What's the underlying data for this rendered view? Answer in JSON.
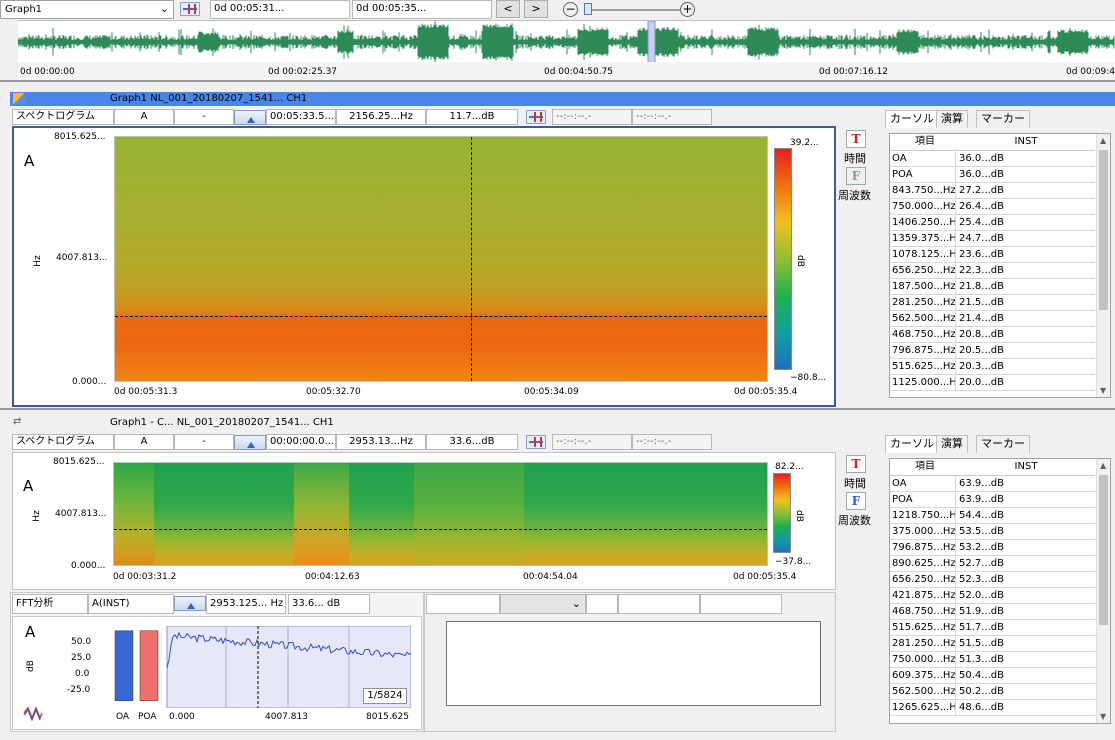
{
  "top": {
    "graph_select": "Graph1",
    "time_start": "0d 00:05:31...",
    "time_end": "0d 00:05:35...",
    "overview_ticks": [
      "0d 00:00:00",
      "0d 00:02:25.37",
      "0d 00:04:50.75",
      "0d 00:07:16.12",
      "0d 00:09:4"
    ]
  },
  "graph1": {
    "title": "Graph1  NL_001_20180207_1541...  CH1",
    "toolbar": {
      "mode": "スペクトログラム",
      "weight": "A",
      "dash": "-",
      "time": "00:05:33.5...",
      "freq": "2156.25...Hz",
      "level": "11.7...dB",
      "blank1": "--:--:--.-",
      "blank2": "--:--:--.-"
    },
    "y_ticks": [
      "8015.625...",
      "4007.813...",
      "0.000..."
    ],
    "y_unit": "Hz",
    "corner": "A",
    "x_ticks": [
      "0d 00:05:31.3",
      "00:05:32.70",
      "00:05:34.09",
      "0d 00:05:35.4"
    ],
    "scale_max": "39.2...",
    "scale_min": "−80.8...",
    "scale_unit": "dB",
    "side": {
      "t_label": "時間",
      "f_label": "周波数"
    }
  },
  "graph2": {
    "title": "Graph1 - C...  NL_001_20180207_1541...  CH1",
    "toolbar": {
      "mode": "スペクトログラム",
      "weight": "A",
      "dash": "-",
      "time": "00:00:00.0...",
      "freq": "2953.13...Hz",
      "level": "33.6...dB",
      "blank1": "--:--:--.-",
      "blank2": "--:--:--.-"
    },
    "y_ticks": [
      "8015.625...",
      "4007.813...",
      "0.000..."
    ],
    "y_unit": "Hz",
    "corner": "A",
    "x_ticks": [
      "0d 00:03:31.2",
      "00:04:12.63",
      "00:04:54.04",
      "0d 00:05:35.4"
    ],
    "scale_max": "82.2...",
    "scale_min": "−37.8...",
    "scale_unit": "dB",
    "side": {
      "t_label": "時間",
      "f_label": "周波数"
    }
  },
  "fft": {
    "mode": "FFT分析",
    "weight": "A(INST)",
    "freq": "2953.125...",
    "freq_unit": "Hz",
    "level": "33.6... dB",
    "corner": "A",
    "y_unit": "dB",
    "counter": "1/5824",
    "x_ticks": [
      "0.000",
      "4007.813",
      "8015.625"
    ]
  },
  "chart_data": {
    "type": "bar",
    "title": "",
    "categories": [
      "OA",
      "POA"
    ],
    "values": [
      63.9,
      63.9
    ],
    "colors": [
      "#3a66d6",
      "#f07070"
    ],
    "ylabel": "dB",
    "y_ticks": [
      "50.0",
      "25.0",
      "0.0",
      "-25.0"
    ]
  },
  "panel1": {
    "tabs": [
      "カーソル",
      "演算",
      "マーカー"
    ],
    "col1": "項目",
    "col2": "INST",
    "rows": [
      [
        "OA",
        "36.0...dB"
      ],
      [
        "POA",
        "36.0...dB"
      ],
      [
        "843.750...Hz",
        "27.2...dB"
      ],
      [
        "750.000...Hz",
        "26.4...dB"
      ],
      [
        "1406.250...Hz",
        "25.4...dB"
      ],
      [
        "1359.375...Hz",
        "24.7...dB"
      ],
      [
        "1078.125...Hz",
        "23.6...dB"
      ],
      [
        "656.250...Hz",
        "22.3...dB"
      ],
      [
        "187.500...Hz",
        "21.8...dB"
      ],
      [
        "281.250...Hz",
        "21.5...dB"
      ],
      [
        "562.500...Hz",
        "21.4...dB"
      ],
      [
        "468.750...Hz",
        "20.8...dB"
      ],
      [
        "796.875...Hz",
        "20.5...dB"
      ],
      [
        "515.625...Hz",
        "20.3...dB"
      ],
      [
        "1125.000...Hz",
        "20.0...dB"
      ]
    ]
  },
  "panel2": {
    "tabs": [
      "カーソル",
      "演算",
      "マーカー"
    ],
    "col1": "項目",
    "col2": "INST",
    "rows": [
      [
        "OA",
        "63.9...dB"
      ],
      [
        "POA",
        "63.9...dB"
      ],
      [
        "1218.750...Hz",
        "54.4...dB"
      ],
      [
        "375.000...Hz",
        "53.5...dB"
      ],
      [
        "796.875...Hz",
        "53.2...dB"
      ],
      [
        "890.625...Hz",
        "52.7...dB"
      ],
      [
        "656.250...Hz",
        "52.3...dB"
      ],
      [
        "421.875...Hz",
        "52.0...dB"
      ],
      [
        "468.750...Hz",
        "51.9...dB"
      ],
      [
        "515.625...Hz",
        "51.7...dB"
      ],
      [
        "281.250...Hz",
        "51.5...dB"
      ],
      [
        "750.000...Hz",
        "51.3...dB"
      ],
      [
        "609.375...Hz",
        "50.4...dB"
      ],
      [
        "562.500...Hz",
        "50.2...dB"
      ],
      [
        "1265.625...Hz",
        "48.6...dB"
      ]
    ]
  }
}
